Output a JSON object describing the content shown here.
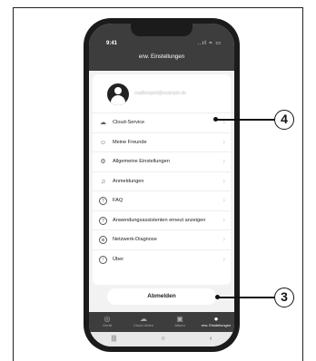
{
  "status_bar": {
    "time": "9:41",
    "icons": "..ıl ≈ ▭"
  },
  "header": {
    "title": "erw. Einstellungen"
  },
  "profile": {
    "email": "mailbeispiel@example.de"
  },
  "menu": [
    {
      "label": "Cloud-Service",
      "icon": "cloud-icon"
    },
    {
      "label": "Meine Freunde",
      "icon": "friends-icon"
    },
    {
      "label": "Allgemeine Einstellungen",
      "icon": "settings-icon"
    },
    {
      "label": "Anmeldungen",
      "icon": "bell-icon"
    },
    {
      "label": "FAQ",
      "icon": "question-icon"
    },
    {
      "label": "Anwendungsassistenten erneut anzeigen",
      "icon": "assistant-icon"
    },
    {
      "label": "Netzwerk-Diagnose",
      "icon": "network-icon"
    },
    {
      "label": "Über",
      "icon": "info-icon"
    }
  ],
  "logout_label": "Abmelden",
  "tabs": [
    {
      "label": "Gerät",
      "icon": "camera-icon"
    },
    {
      "label": "Cloud-Video",
      "icon": "cloud-video-icon"
    },
    {
      "label": "Album",
      "icon": "album-icon"
    },
    {
      "label": "erw. Einstellungen",
      "icon": "user-settings-icon",
      "active": true
    }
  ],
  "nav": {
    "recents": "|||",
    "home": "○",
    "back": "‹"
  },
  "callouts": {
    "a": "4",
    "b": "3"
  }
}
